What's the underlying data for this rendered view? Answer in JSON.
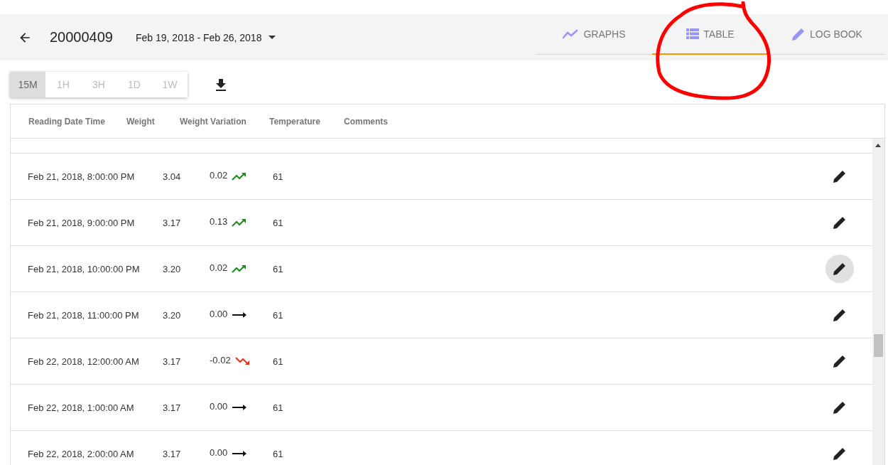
{
  "header": {
    "title": "20000409",
    "date_range": "Feb 19, 2018 - Feb 26, 2018"
  },
  "tabs": [
    {
      "label": "GRAPHS",
      "kind": "graphs",
      "selected": false
    },
    {
      "label": "TABLE",
      "kind": "table",
      "selected": true
    },
    {
      "label": "LOG BOOK",
      "kind": "logbook",
      "selected": false
    }
  ],
  "intervals": [
    {
      "label": "15M",
      "selected": true
    },
    {
      "label": "1H",
      "selected": false
    },
    {
      "label": "3H",
      "selected": false
    },
    {
      "label": "1D",
      "selected": false
    },
    {
      "label": "1W",
      "selected": false
    }
  ],
  "table": {
    "columns": [
      "Reading Date Time",
      "Weight",
      "Weight Variation",
      "Temperature",
      "Comments"
    ],
    "rows": [
      {
        "time": "Feb 21, 2018, 8:00:00 PM",
        "weight": "3.04",
        "variation": "0.02",
        "kind": "up",
        "temperature": "61",
        "edit_hover": false
      },
      {
        "time": "Feb 21, 2018, 9:00:00 PM",
        "weight": "3.17",
        "variation": "0.13",
        "kind": "up",
        "temperature": "61",
        "edit_hover": false
      },
      {
        "time": "Feb 21, 2018, 10:00:00 PM",
        "weight": "3.20",
        "variation": "0.02",
        "kind": "up",
        "temperature": "61",
        "edit_hover": true
      },
      {
        "time": "Feb 21, 2018, 11:00:00 PM",
        "weight": "3.20",
        "variation": "0.00",
        "kind": "flat",
        "temperature": "61",
        "edit_hover": false
      },
      {
        "time": "Feb 22, 2018, 12:00:00 AM",
        "weight": "3.17",
        "variation": "-0.02",
        "kind": "down",
        "temperature": "61",
        "edit_hover": false
      },
      {
        "time": "Feb 22, 2018, 1:00:00 AM",
        "weight": "3.17",
        "variation": "0.00",
        "kind": "flat",
        "temperature": "61",
        "edit_hover": false
      },
      {
        "time": "Feb 22, 2018, 2:00:00 AM",
        "weight": "3.17",
        "variation": "0.00",
        "kind": "flat",
        "temperature": "61",
        "edit_hover": false
      }
    ]
  }
}
